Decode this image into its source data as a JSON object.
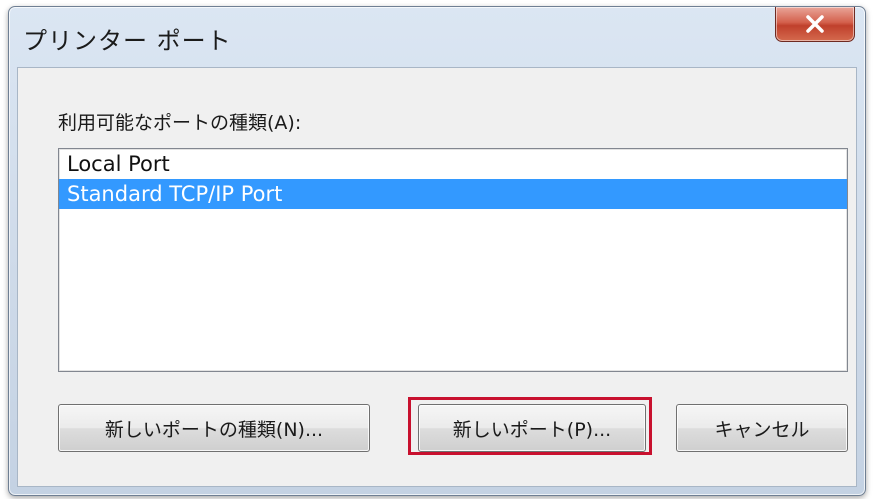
{
  "dialog": {
    "title": "プリンター ポート",
    "close_label": "x"
  },
  "port_list": {
    "label": "利用可能なポートの種類(A):",
    "items": [
      {
        "label": "Local Port",
        "selected": false
      },
      {
        "label": "Standard TCP/IP Port",
        "selected": true
      }
    ]
  },
  "buttons": {
    "new_port_type": "新しいポートの種類(N)...",
    "new_port": "新しいポート(P)...",
    "cancel": "キャンセル"
  },
  "colors": {
    "selection": "#3399ff",
    "highlight_box": "#c8102e",
    "close_button": "#c0402c"
  }
}
